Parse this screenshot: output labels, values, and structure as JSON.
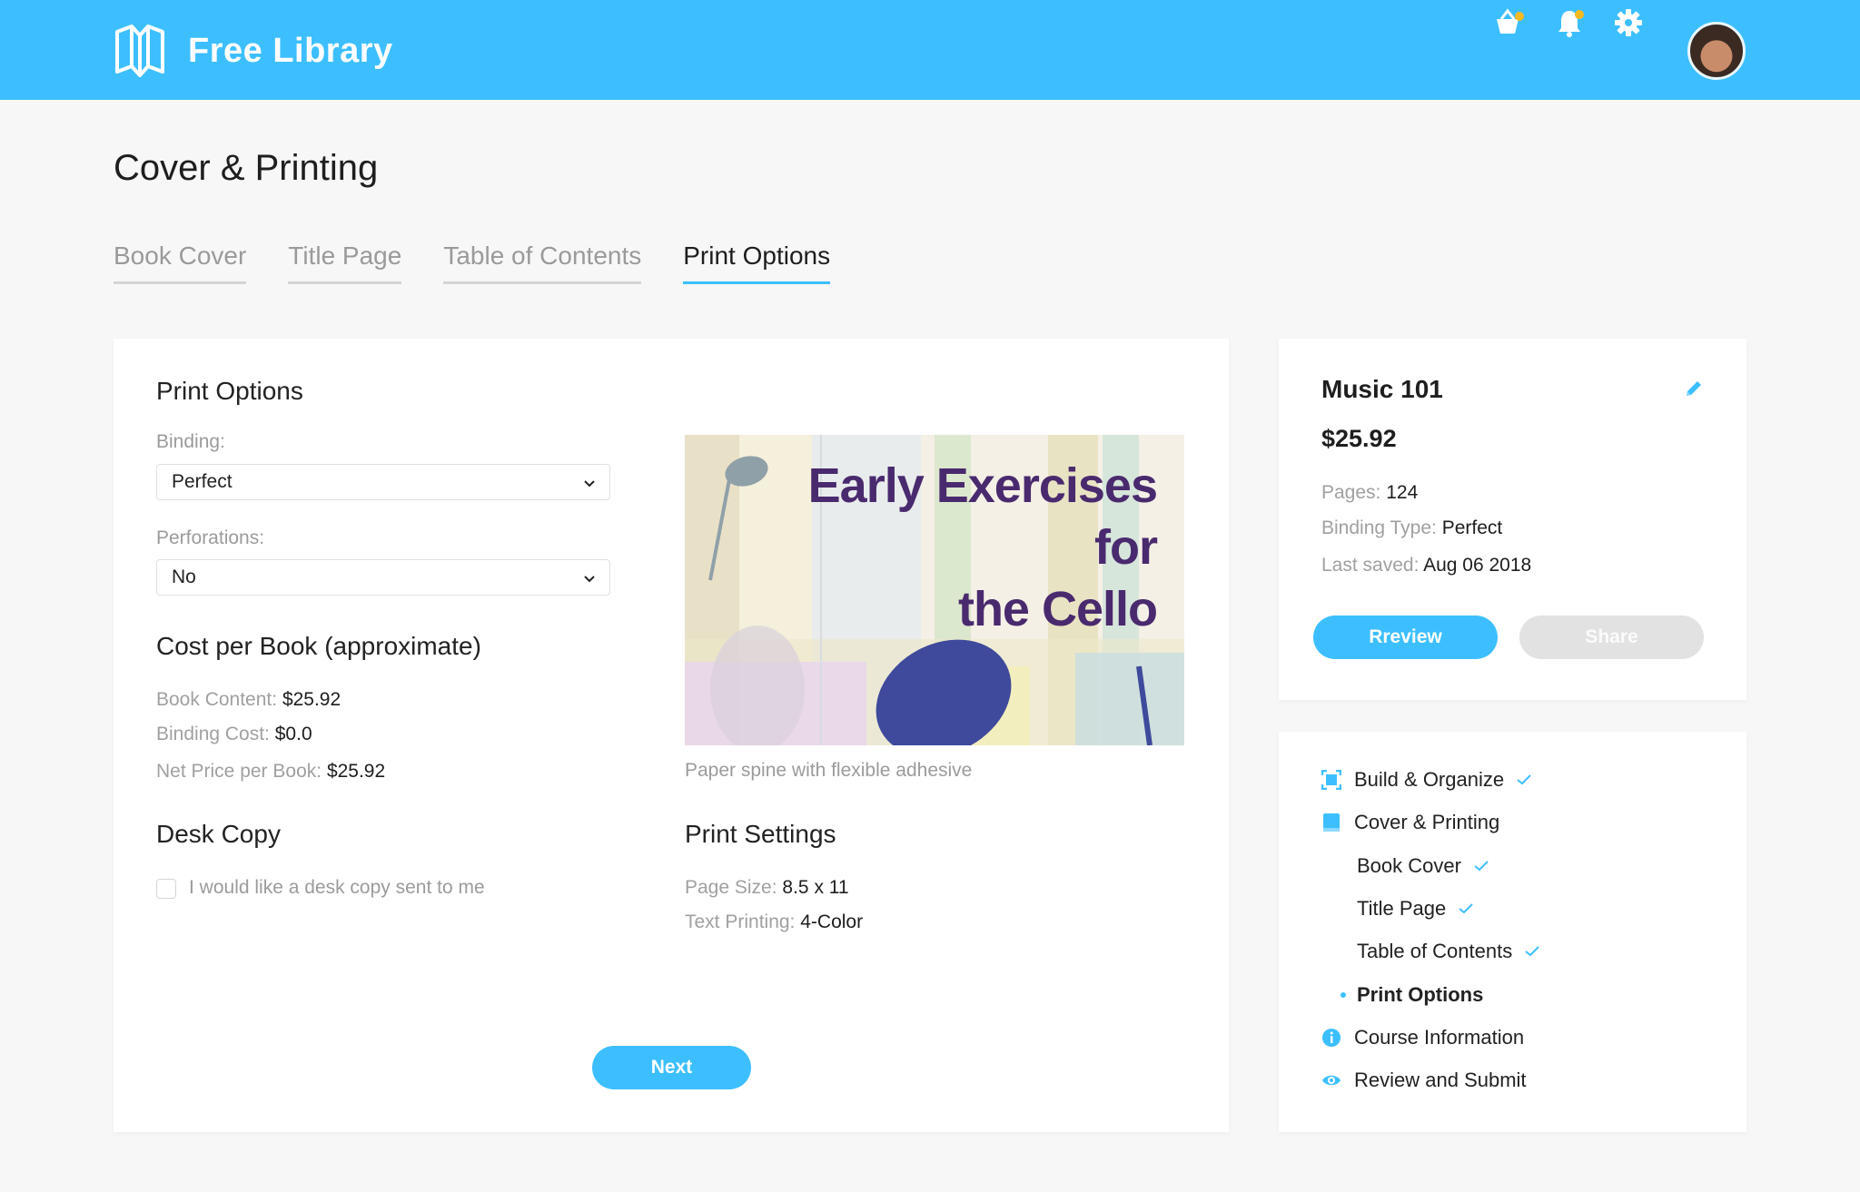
{
  "header": {
    "brand": "Free Library",
    "icons": [
      "book-logo-icon",
      "basket-icon",
      "bell-icon",
      "gear-icon",
      "avatar"
    ],
    "accent": "#3dbfff",
    "notification_dot": "#f5b921"
  },
  "page": {
    "title": "Cover & Printing",
    "tabs": [
      {
        "label": "Book Cover"
      },
      {
        "label": "Title Page"
      },
      {
        "label": "Table of Contents"
      },
      {
        "label": "Print Options",
        "active": true
      }
    ]
  },
  "print_options": {
    "title": "Print Options",
    "binding_label": "Binding:",
    "binding_value": "Perfect",
    "perforations_label": "Perforations:",
    "perforations_value": "No",
    "cover_title_lines": [
      "Early Exercises",
      "for",
      "the Cello"
    ],
    "cover_caption": "Paper spine with flexible adhesive"
  },
  "cost": {
    "title": "Cost per Book (approximate)",
    "book_content_label": "Book Content:",
    "book_content_value": "$25.92",
    "binding_cost_label": "Binding Cost:",
    "binding_cost_value": "$0.0",
    "net_price_label": "Net Price per Book:",
    "net_price_value": "$25.92"
  },
  "desk_copy": {
    "title": "Desk Copy",
    "checkbox_label": "I would like a desk copy sent to me",
    "checked": false
  },
  "print_settings": {
    "title": "Print Settings",
    "page_size_label": "Page Size:",
    "page_size_value": "8.5 x 11",
    "text_printing_label": "Text Printing:",
    "text_printing_value": "4-Color"
  },
  "actions": {
    "next_label": "Next"
  },
  "book_info": {
    "title": "Music 101",
    "price": "$25.92",
    "pages_label": "Pages:",
    "pages_value": "124",
    "binding_type_label": "Binding Type:",
    "binding_type_value": "Perfect",
    "last_saved_label": "Last saved:",
    "last_saved_value": "Aug 06 2018",
    "review_label": "Rreview",
    "share_label": "Share"
  },
  "steps": [
    {
      "label": "Build & Organize",
      "icon": "frame-icon",
      "done": true
    },
    {
      "label": "Cover & Printing",
      "icon": "book-icon",
      "done": false
    },
    {
      "label": "Book Cover",
      "sub": true,
      "done": true
    },
    {
      "label": "Title Page",
      "sub": true,
      "done": true
    },
    {
      "label": "Table of Contents",
      "sub": true,
      "done": true
    },
    {
      "label": "Print Options",
      "sub": true,
      "current": true
    },
    {
      "label": "Course Information",
      "icon": "info-icon",
      "done": false
    },
    {
      "label": "Review and Submit",
      "icon": "eye-icon",
      "done": false
    }
  ]
}
